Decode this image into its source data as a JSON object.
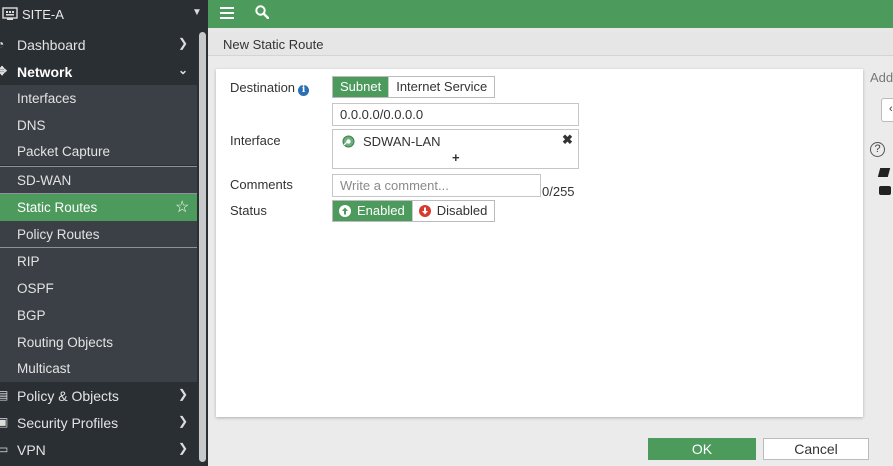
{
  "sidebar": {
    "title": "SITE-A",
    "items": [
      {
        "label": "Dashboard",
        "icon": "dashboard-icon"
      },
      {
        "label": "Network",
        "icon": "network-icon"
      },
      {
        "label": "Interfaces"
      },
      {
        "label": "DNS"
      },
      {
        "label": "Packet Capture"
      },
      {
        "label": "SD-WAN"
      },
      {
        "label": "Static Routes"
      },
      {
        "label": "Policy Routes"
      },
      {
        "label": "RIP"
      },
      {
        "label": "OSPF"
      },
      {
        "label": "BGP"
      },
      {
        "label": "Routing Objects"
      },
      {
        "label": "Multicast"
      },
      {
        "label": "Policy & Objects",
        "icon": "policy-icon"
      },
      {
        "label": "Security Profiles",
        "icon": "lock-icon"
      },
      {
        "label": "VPN",
        "icon": "vpn-icon"
      }
    ]
  },
  "page": {
    "title": "New Static Route"
  },
  "form": {
    "destination_label": "Destination",
    "dest_options": [
      "Subnet",
      "Internet Service"
    ],
    "dest_selected": "Subnet",
    "subnet_value": "0.0.0.0/0.0.0.0",
    "interface_label": "Interface",
    "interface_value": "SDWAN-LAN",
    "interface_remove": "✖",
    "interface_add": "+",
    "comments_label": "Comments",
    "comments_placeholder": "Write a comment...",
    "comments_count": "0/255",
    "status_label": "Status",
    "status_options": [
      "Enabled",
      "Disabled"
    ],
    "status_selected": "Enabled"
  },
  "side_panel": {
    "add_text": "Add"
  },
  "footer": {
    "ok_label": "OK",
    "cancel_label": "Cancel"
  },
  "colors": {
    "accent": "#4d9a5d",
    "sidebar_bg": "#2a2f33",
    "danger": "#d93a2e",
    "info": "#2c6fb2"
  }
}
